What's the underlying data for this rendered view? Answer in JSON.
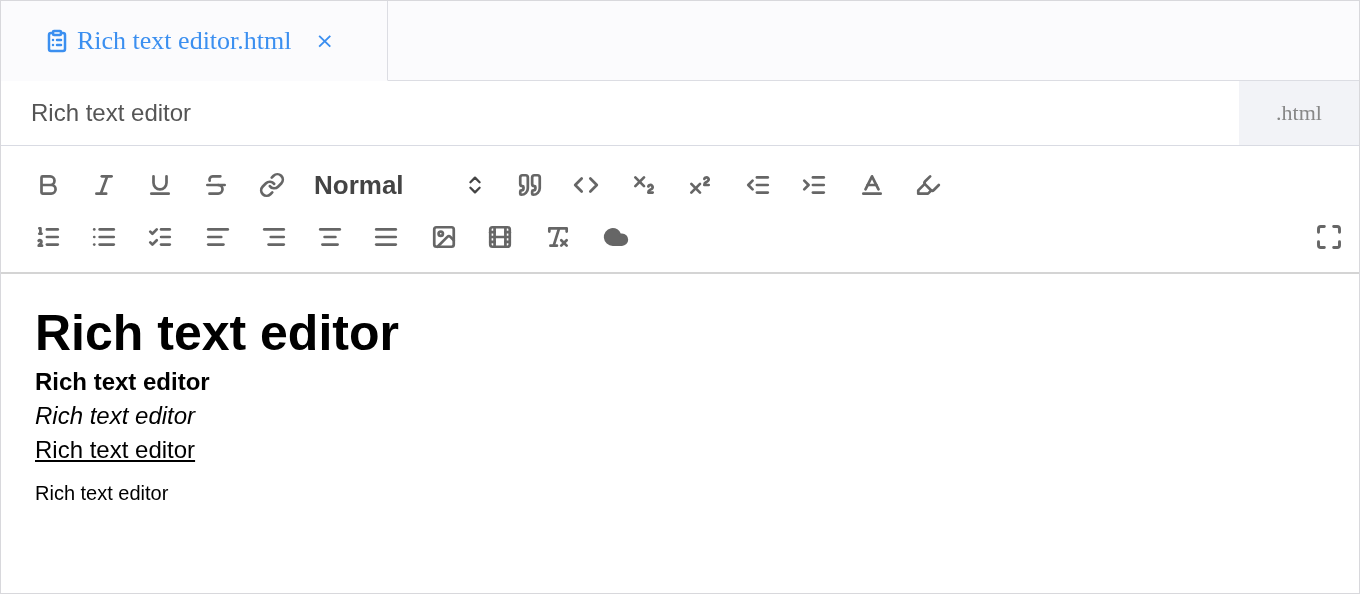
{
  "tabs": [
    {
      "label": "Rich text editor.html",
      "selected": true,
      "close": "×"
    }
  ],
  "title_field": {
    "value": "Rich text editor",
    "suffix": ".html"
  },
  "toolbar": {
    "rows": [
      [
        [
          {
            "kind": "bold"
          },
          {
            "kind": "italic"
          },
          {
            "kind": "underline"
          },
          {
            "kind": "strike"
          },
          {
            "kind": "link"
          },
          {
            "kind": "select",
            "value": "Normal"
          }
        ],
        [
          {
            "kind": "quote"
          },
          {
            "kind": "code"
          }
        ],
        [
          {
            "kind": "subscript"
          },
          {
            "kind": "superscript"
          }
        ],
        [
          {
            "kind": "outdent"
          },
          {
            "kind": "indent"
          }
        ],
        [
          {
            "kind": "color"
          },
          {
            "kind": "background"
          }
        ]
      ],
      [
        [
          {
            "kind": "ordered-list"
          },
          {
            "kind": "bullet-list"
          },
          {
            "kind": "check-list"
          }
        ],
        [
          {
            "kind": "align-left"
          },
          {
            "kind": "align-right"
          },
          {
            "kind": "align-center"
          },
          {
            "kind": "align-justify"
          }
        ],
        [
          {
            "kind": "image"
          },
          {
            "kind": "video"
          }
        ],
        [
          {
            "kind": "clean"
          }
        ],
        [
          {
            "kind": "cloud"
          }
        ]
      ]
    ],
    "end": {
      "kind": "fullscreen"
    }
  },
  "content": [
    {
      "kind": "heading",
      "text": "Rich text editor"
    },
    {
      "kind": "bold",
      "text": "Rich text editor"
    },
    {
      "kind": "italic",
      "text": "Rich text editor"
    },
    {
      "kind": "underline",
      "text": "Rich text editor"
    },
    {
      "kind": "normal",
      "text": "Rich text editor"
    }
  ]
}
